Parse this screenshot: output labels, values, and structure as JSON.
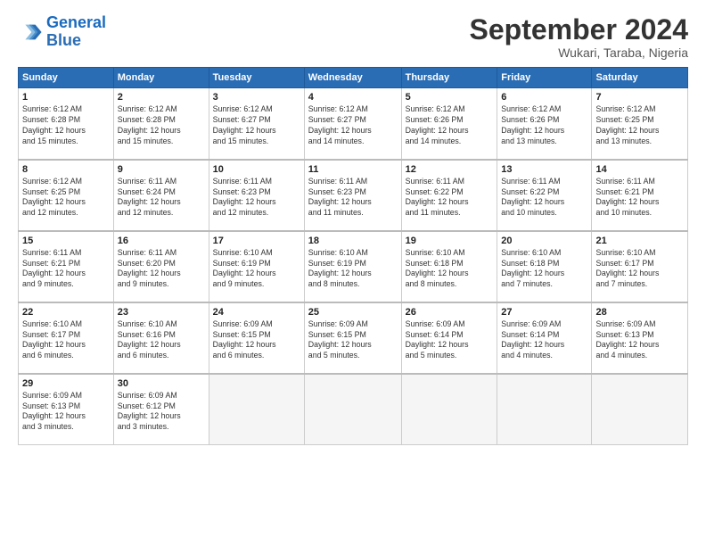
{
  "logo": {
    "line1": "General",
    "line2": "Blue"
  },
  "title": "September 2024",
  "subtitle": "Wukari, Taraba, Nigeria",
  "columns": [
    "Sunday",
    "Monday",
    "Tuesday",
    "Wednesday",
    "Thursday",
    "Friday",
    "Saturday"
  ],
  "weeks": [
    [
      {
        "day": "1",
        "info": "Sunrise: 6:12 AM\nSunset: 6:28 PM\nDaylight: 12 hours\nand 15 minutes."
      },
      {
        "day": "2",
        "info": "Sunrise: 6:12 AM\nSunset: 6:28 PM\nDaylight: 12 hours\nand 15 minutes."
      },
      {
        "day": "3",
        "info": "Sunrise: 6:12 AM\nSunset: 6:27 PM\nDaylight: 12 hours\nand 15 minutes."
      },
      {
        "day": "4",
        "info": "Sunrise: 6:12 AM\nSunset: 6:27 PM\nDaylight: 12 hours\nand 14 minutes."
      },
      {
        "day": "5",
        "info": "Sunrise: 6:12 AM\nSunset: 6:26 PM\nDaylight: 12 hours\nand 14 minutes."
      },
      {
        "day": "6",
        "info": "Sunrise: 6:12 AM\nSunset: 6:26 PM\nDaylight: 12 hours\nand 13 minutes."
      },
      {
        "day": "7",
        "info": "Sunrise: 6:12 AM\nSunset: 6:25 PM\nDaylight: 12 hours\nand 13 minutes."
      }
    ],
    [
      {
        "day": "8",
        "info": "Sunrise: 6:12 AM\nSunset: 6:25 PM\nDaylight: 12 hours\nand 12 minutes."
      },
      {
        "day": "9",
        "info": "Sunrise: 6:11 AM\nSunset: 6:24 PM\nDaylight: 12 hours\nand 12 minutes."
      },
      {
        "day": "10",
        "info": "Sunrise: 6:11 AM\nSunset: 6:23 PM\nDaylight: 12 hours\nand 12 minutes."
      },
      {
        "day": "11",
        "info": "Sunrise: 6:11 AM\nSunset: 6:23 PM\nDaylight: 12 hours\nand 11 minutes."
      },
      {
        "day": "12",
        "info": "Sunrise: 6:11 AM\nSunset: 6:22 PM\nDaylight: 12 hours\nand 11 minutes."
      },
      {
        "day": "13",
        "info": "Sunrise: 6:11 AM\nSunset: 6:22 PM\nDaylight: 12 hours\nand 10 minutes."
      },
      {
        "day": "14",
        "info": "Sunrise: 6:11 AM\nSunset: 6:21 PM\nDaylight: 12 hours\nand 10 minutes."
      }
    ],
    [
      {
        "day": "15",
        "info": "Sunrise: 6:11 AM\nSunset: 6:21 PM\nDaylight: 12 hours\nand 9 minutes."
      },
      {
        "day": "16",
        "info": "Sunrise: 6:11 AM\nSunset: 6:20 PM\nDaylight: 12 hours\nand 9 minutes."
      },
      {
        "day": "17",
        "info": "Sunrise: 6:10 AM\nSunset: 6:19 PM\nDaylight: 12 hours\nand 9 minutes."
      },
      {
        "day": "18",
        "info": "Sunrise: 6:10 AM\nSunset: 6:19 PM\nDaylight: 12 hours\nand 8 minutes."
      },
      {
        "day": "19",
        "info": "Sunrise: 6:10 AM\nSunset: 6:18 PM\nDaylight: 12 hours\nand 8 minutes."
      },
      {
        "day": "20",
        "info": "Sunrise: 6:10 AM\nSunset: 6:18 PM\nDaylight: 12 hours\nand 7 minutes."
      },
      {
        "day": "21",
        "info": "Sunrise: 6:10 AM\nSunset: 6:17 PM\nDaylight: 12 hours\nand 7 minutes."
      }
    ],
    [
      {
        "day": "22",
        "info": "Sunrise: 6:10 AM\nSunset: 6:17 PM\nDaylight: 12 hours\nand 6 minutes."
      },
      {
        "day": "23",
        "info": "Sunrise: 6:10 AM\nSunset: 6:16 PM\nDaylight: 12 hours\nand 6 minutes."
      },
      {
        "day": "24",
        "info": "Sunrise: 6:09 AM\nSunset: 6:15 PM\nDaylight: 12 hours\nand 6 minutes."
      },
      {
        "day": "25",
        "info": "Sunrise: 6:09 AM\nSunset: 6:15 PM\nDaylight: 12 hours\nand 5 minutes."
      },
      {
        "day": "26",
        "info": "Sunrise: 6:09 AM\nSunset: 6:14 PM\nDaylight: 12 hours\nand 5 minutes."
      },
      {
        "day": "27",
        "info": "Sunrise: 6:09 AM\nSunset: 6:14 PM\nDaylight: 12 hours\nand 4 minutes."
      },
      {
        "day": "28",
        "info": "Sunrise: 6:09 AM\nSunset: 6:13 PM\nDaylight: 12 hours\nand 4 minutes."
      }
    ],
    [
      {
        "day": "29",
        "info": "Sunrise: 6:09 AM\nSunset: 6:13 PM\nDaylight: 12 hours\nand 3 minutes."
      },
      {
        "day": "30",
        "info": "Sunrise: 6:09 AM\nSunset: 6:12 PM\nDaylight: 12 hours\nand 3 minutes."
      },
      {
        "day": "",
        "info": ""
      },
      {
        "day": "",
        "info": ""
      },
      {
        "day": "",
        "info": ""
      },
      {
        "day": "",
        "info": ""
      },
      {
        "day": "",
        "info": ""
      }
    ]
  ]
}
